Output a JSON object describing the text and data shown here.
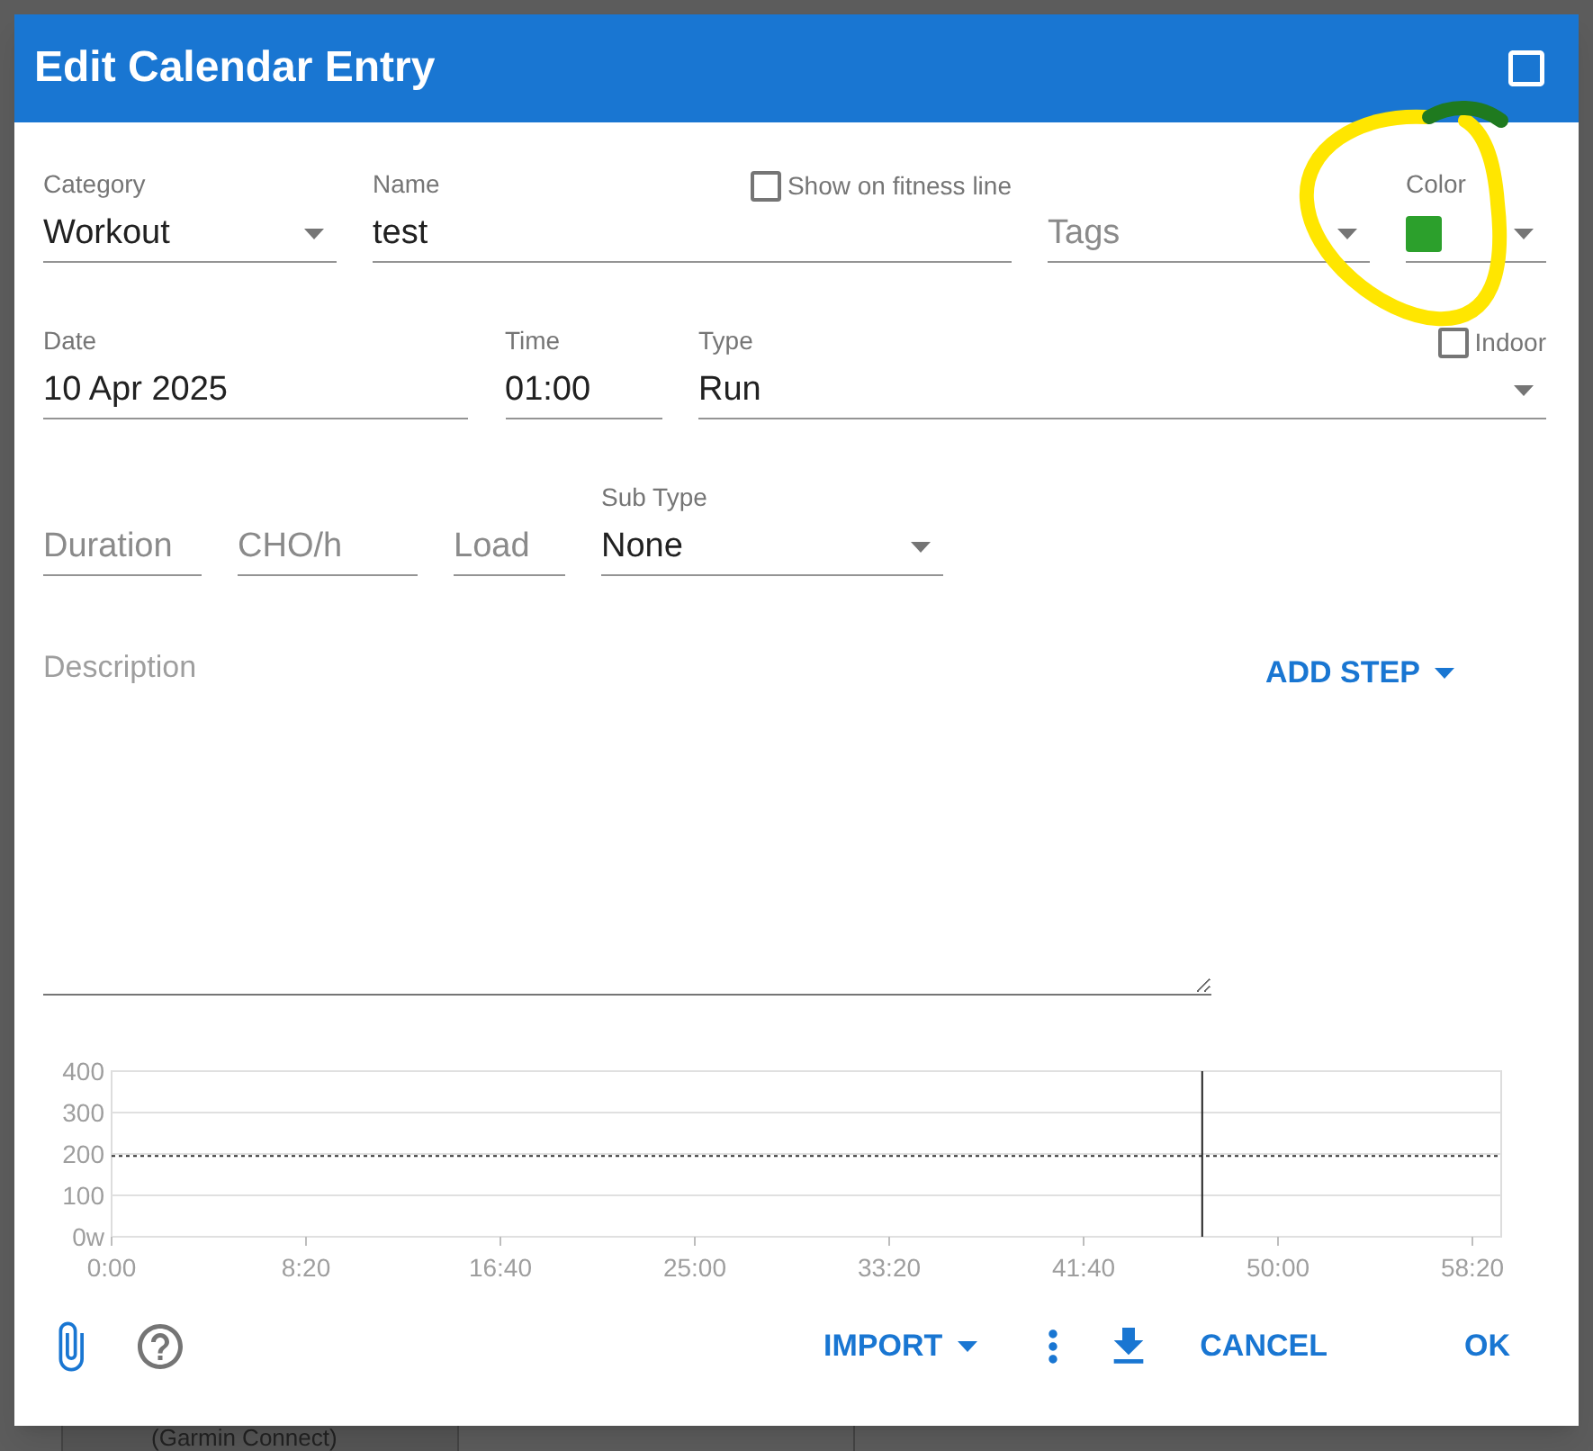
{
  "dialog": {
    "title": "Edit Calendar Entry"
  },
  "rows": [
    [
      {
        "kind": "select",
        "label": "Category",
        "value": "Workout"
      },
      {
        "kind": "text",
        "label": "Name",
        "value": "test",
        "checkbox": {
          "label": "Show on fitness line",
          "checked": false
        }
      },
      {
        "kind": "placeholder_select",
        "placeholder": "Tags"
      },
      {
        "kind": "color",
        "label": "Color",
        "color": "#2ca02c"
      }
    ],
    [
      {
        "kind": "text",
        "label": "Date",
        "value": "10 Apr 2025"
      },
      {
        "kind": "text",
        "label": "Time",
        "value": "01:00"
      },
      {
        "kind": "select",
        "label": "Type",
        "value": "Run",
        "checkbox": {
          "label": "Indoor",
          "checked": false
        }
      }
    ],
    [
      {
        "kind": "placeholder",
        "placeholder": "Duration"
      },
      {
        "kind": "placeholder",
        "placeholder": "CHO/h"
      },
      {
        "kind": "placeholder",
        "placeholder": "Load"
      },
      {
        "kind": "select",
        "label": "Sub Type",
        "value": "None"
      }
    ]
  ],
  "description": {
    "placeholder": "Description"
  },
  "add_step_button": "ADD STEP",
  "chart_data": {
    "type": "line",
    "xlim": [
      0,
      3574
    ],
    "ylim": [
      0,
      400
    ],
    "xticks": [
      {
        "value": 0,
        "label": "0:00"
      },
      {
        "value": 500,
        "label": "8:20"
      },
      {
        "value": 1000,
        "label": "16:40"
      },
      {
        "value": 1500,
        "label": "25:00"
      },
      {
        "value": 2000,
        "label": "33:20"
      },
      {
        "value": 2500,
        "label": "41:40"
      },
      {
        "value": 3000,
        "label": "50:00"
      },
      {
        "value": 3500,
        "label": "58:20"
      }
    ],
    "yticks": [
      {
        "value": 0,
        "label": "0w"
      },
      100,
      200,
      300,
      400
    ],
    "grid": true,
    "ref_lines": [
      {
        "axis": "y",
        "value": 195
      },
      {
        "axis": "x",
        "value": 2805
      }
    ]
  },
  "footer": {
    "import": "IMPORT",
    "cancel": "CANCEL",
    "ok": "OK"
  },
  "backdrop": {
    "text": "(Garmin Connect)"
  }
}
